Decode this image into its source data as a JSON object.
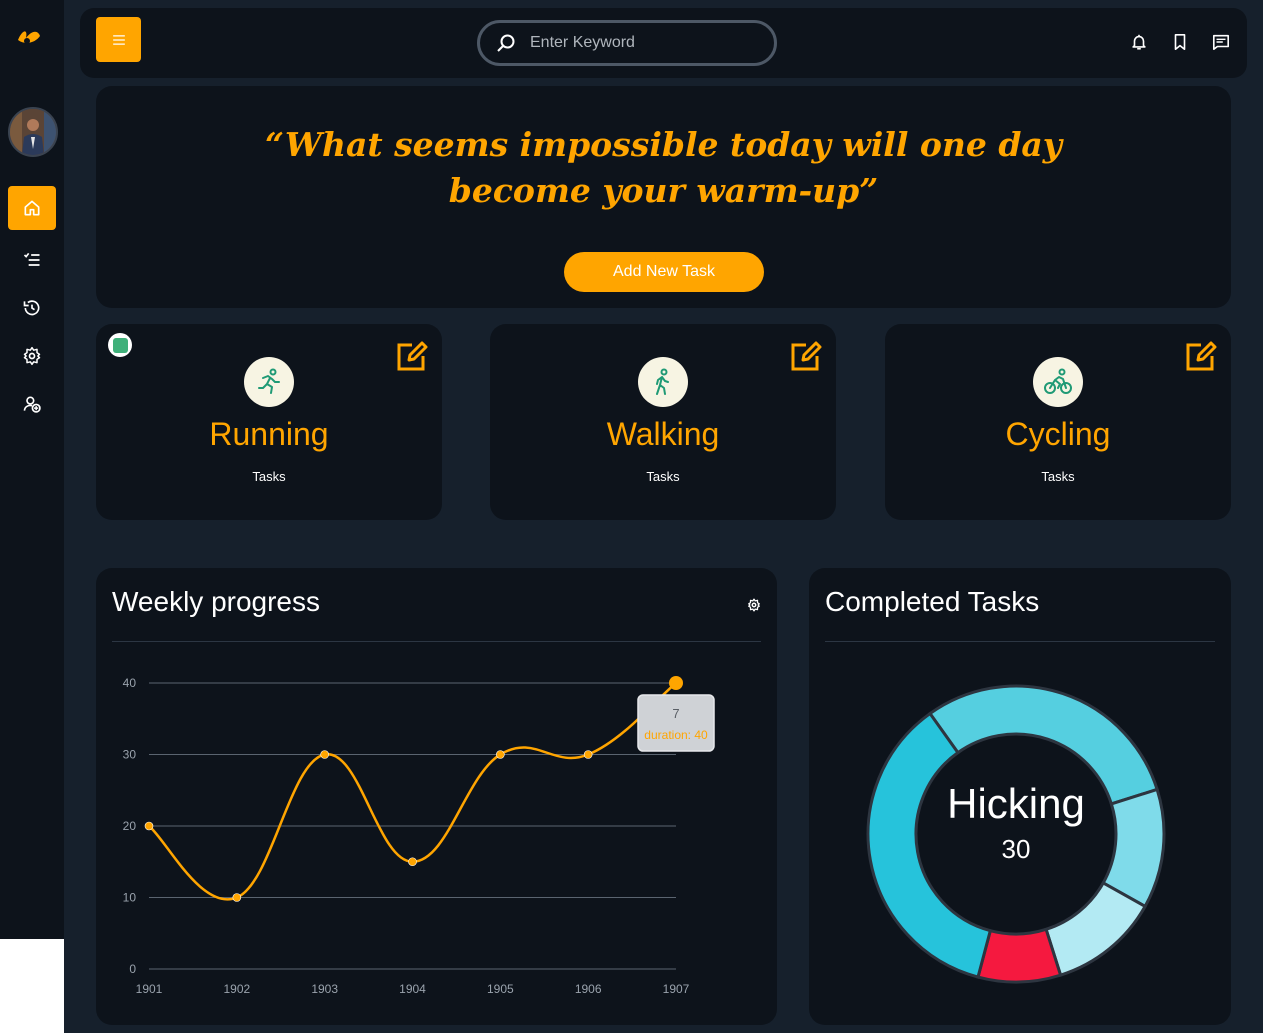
{
  "header": {
    "search_placeholder": "Enter Keyword"
  },
  "quote": {
    "text": "“What seems impossible today will one day become your warm-up”"
  },
  "buttons": {
    "add_task": "Add New Task"
  },
  "cards": [
    {
      "title": "Running",
      "subtitle": "Tasks",
      "icon": "running-icon"
    },
    {
      "title": "Walking",
      "subtitle": "Tasks",
      "icon": "walking-icon"
    },
    {
      "title": "Cycling",
      "subtitle": "Tasks",
      "icon": "cycling-icon"
    }
  ],
  "weekly": {
    "title": "Weekly progress"
  },
  "completed": {
    "title": "Completed Tasks",
    "center_label": "Hicking",
    "center_value": "30"
  },
  "colors": {
    "accent": "#ffa500",
    "panel": "#0d131b",
    "background": "#16202c"
  },
  "chart_data": [
    {
      "type": "line",
      "title": "Weekly progress",
      "x": [
        "1901",
        "1902",
        "1903",
        "1904",
        "1905",
        "1906",
        "1907"
      ],
      "series": [
        {
          "values": [
            20,
            10,
            30,
            15,
            30,
            30,
            40
          ]
        }
      ],
      "y_ticks": [
        0,
        10,
        20,
        30,
        40
      ],
      "ylim": [
        0,
        40
      ],
      "grid": true,
      "tooltip": {
        "title": "7",
        "label": "duration: 40"
      }
    },
    {
      "type": "pie",
      "title": "Completed Tasks",
      "center_label": "Hicking",
      "center_value": "30",
      "values": [
        30,
        13,
        12,
        9,
        36
      ],
      "colors": [
        "#55cfe0",
        "#7fdbea",
        "#b3eaf3",
        "#f5193f",
        "#26c3db"
      ]
    }
  ]
}
